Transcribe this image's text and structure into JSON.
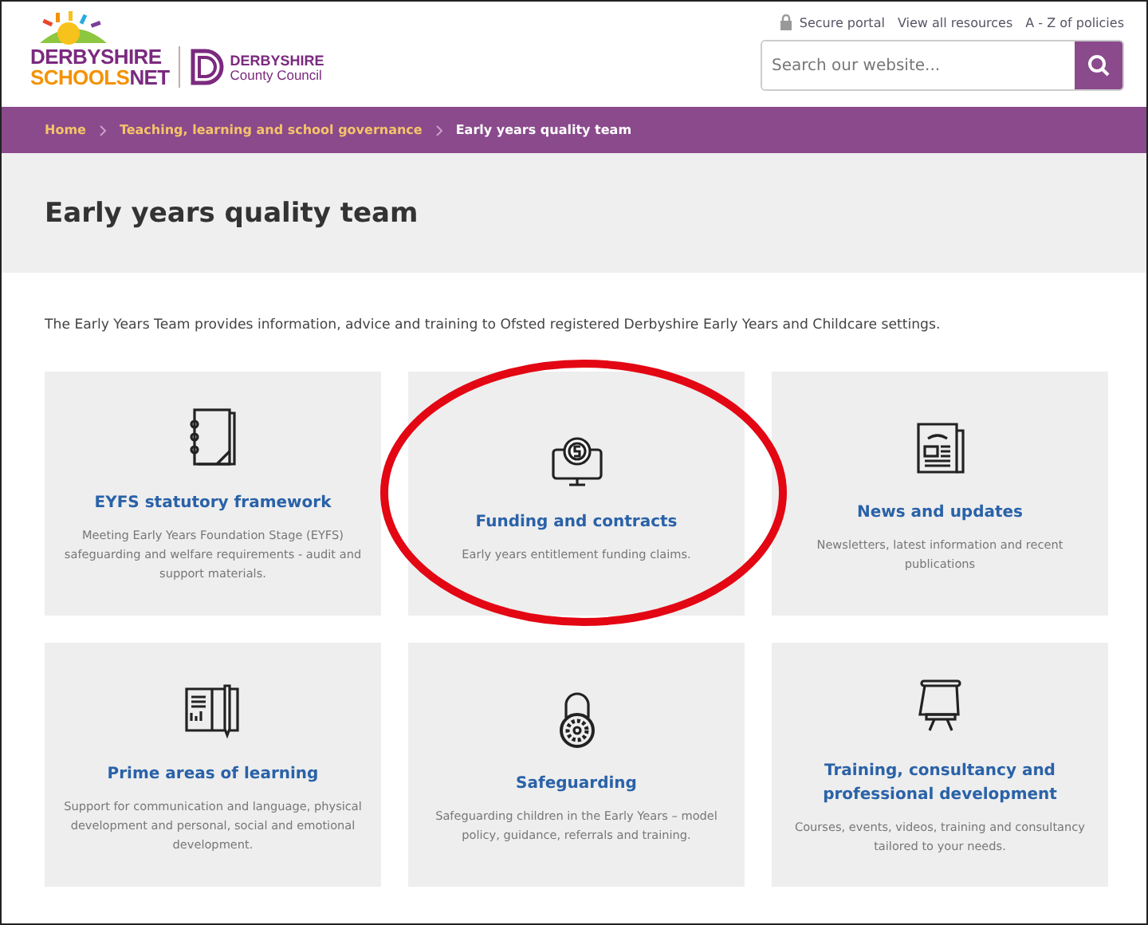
{
  "logo": {
    "line_1": "DERBYSHIRE",
    "line_2a": "SCHOOLS",
    "line_2b": "NET",
    "council_1": "DERBYSHIRE",
    "council_2": "County Council"
  },
  "top_links": [
    "Secure portal",
    "View all resources",
    "A - Z of policies"
  ],
  "search": {
    "placeholder": "Search our website..."
  },
  "breadcrumb": [
    {
      "label": "Home",
      "current": false
    },
    {
      "label": "Teaching, learning and school governance",
      "current": false
    },
    {
      "label": "Early years quality team",
      "current": true
    }
  ],
  "page_title": "Early years quality team",
  "intro": "The Early Years Team provides information, advice and training to Ofsted registered Derbyshire Early Years and Childcare settings.",
  "cards": [
    {
      "title": "EYFS statutory framework",
      "text": "Meeting Early Years Foundation Stage (EYFS) safeguarding and welfare requirements - audit and support materials.",
      "highlighted": false
    },
    {
      "title": "Funding and contracts",
      "text": "Early years entitlement funding claims.",
      "highlighted": true
    },
    {
      "title": "News and updates",
      "text": "Newsletters, latest information and recent publications",
      "highlighted": false
    },
    {
      "title": "Prime areas of learning",
      "text": "Support for communication and language, physical development and personal, social and emotional development.",
      "highlighted": false
    },
    {
      "title": "Safeguarding",
      "text": "Safeguarding children in the Early Years – model policy, guidance, referrals and training.",
      "highlighted": false
    },
    {
      "title": "Training, consultancy and professional development",
      "text": "Courses, events, videos, training and consultancy tailored to your needs.",
      "highlighted": false
    }
  ]
}
